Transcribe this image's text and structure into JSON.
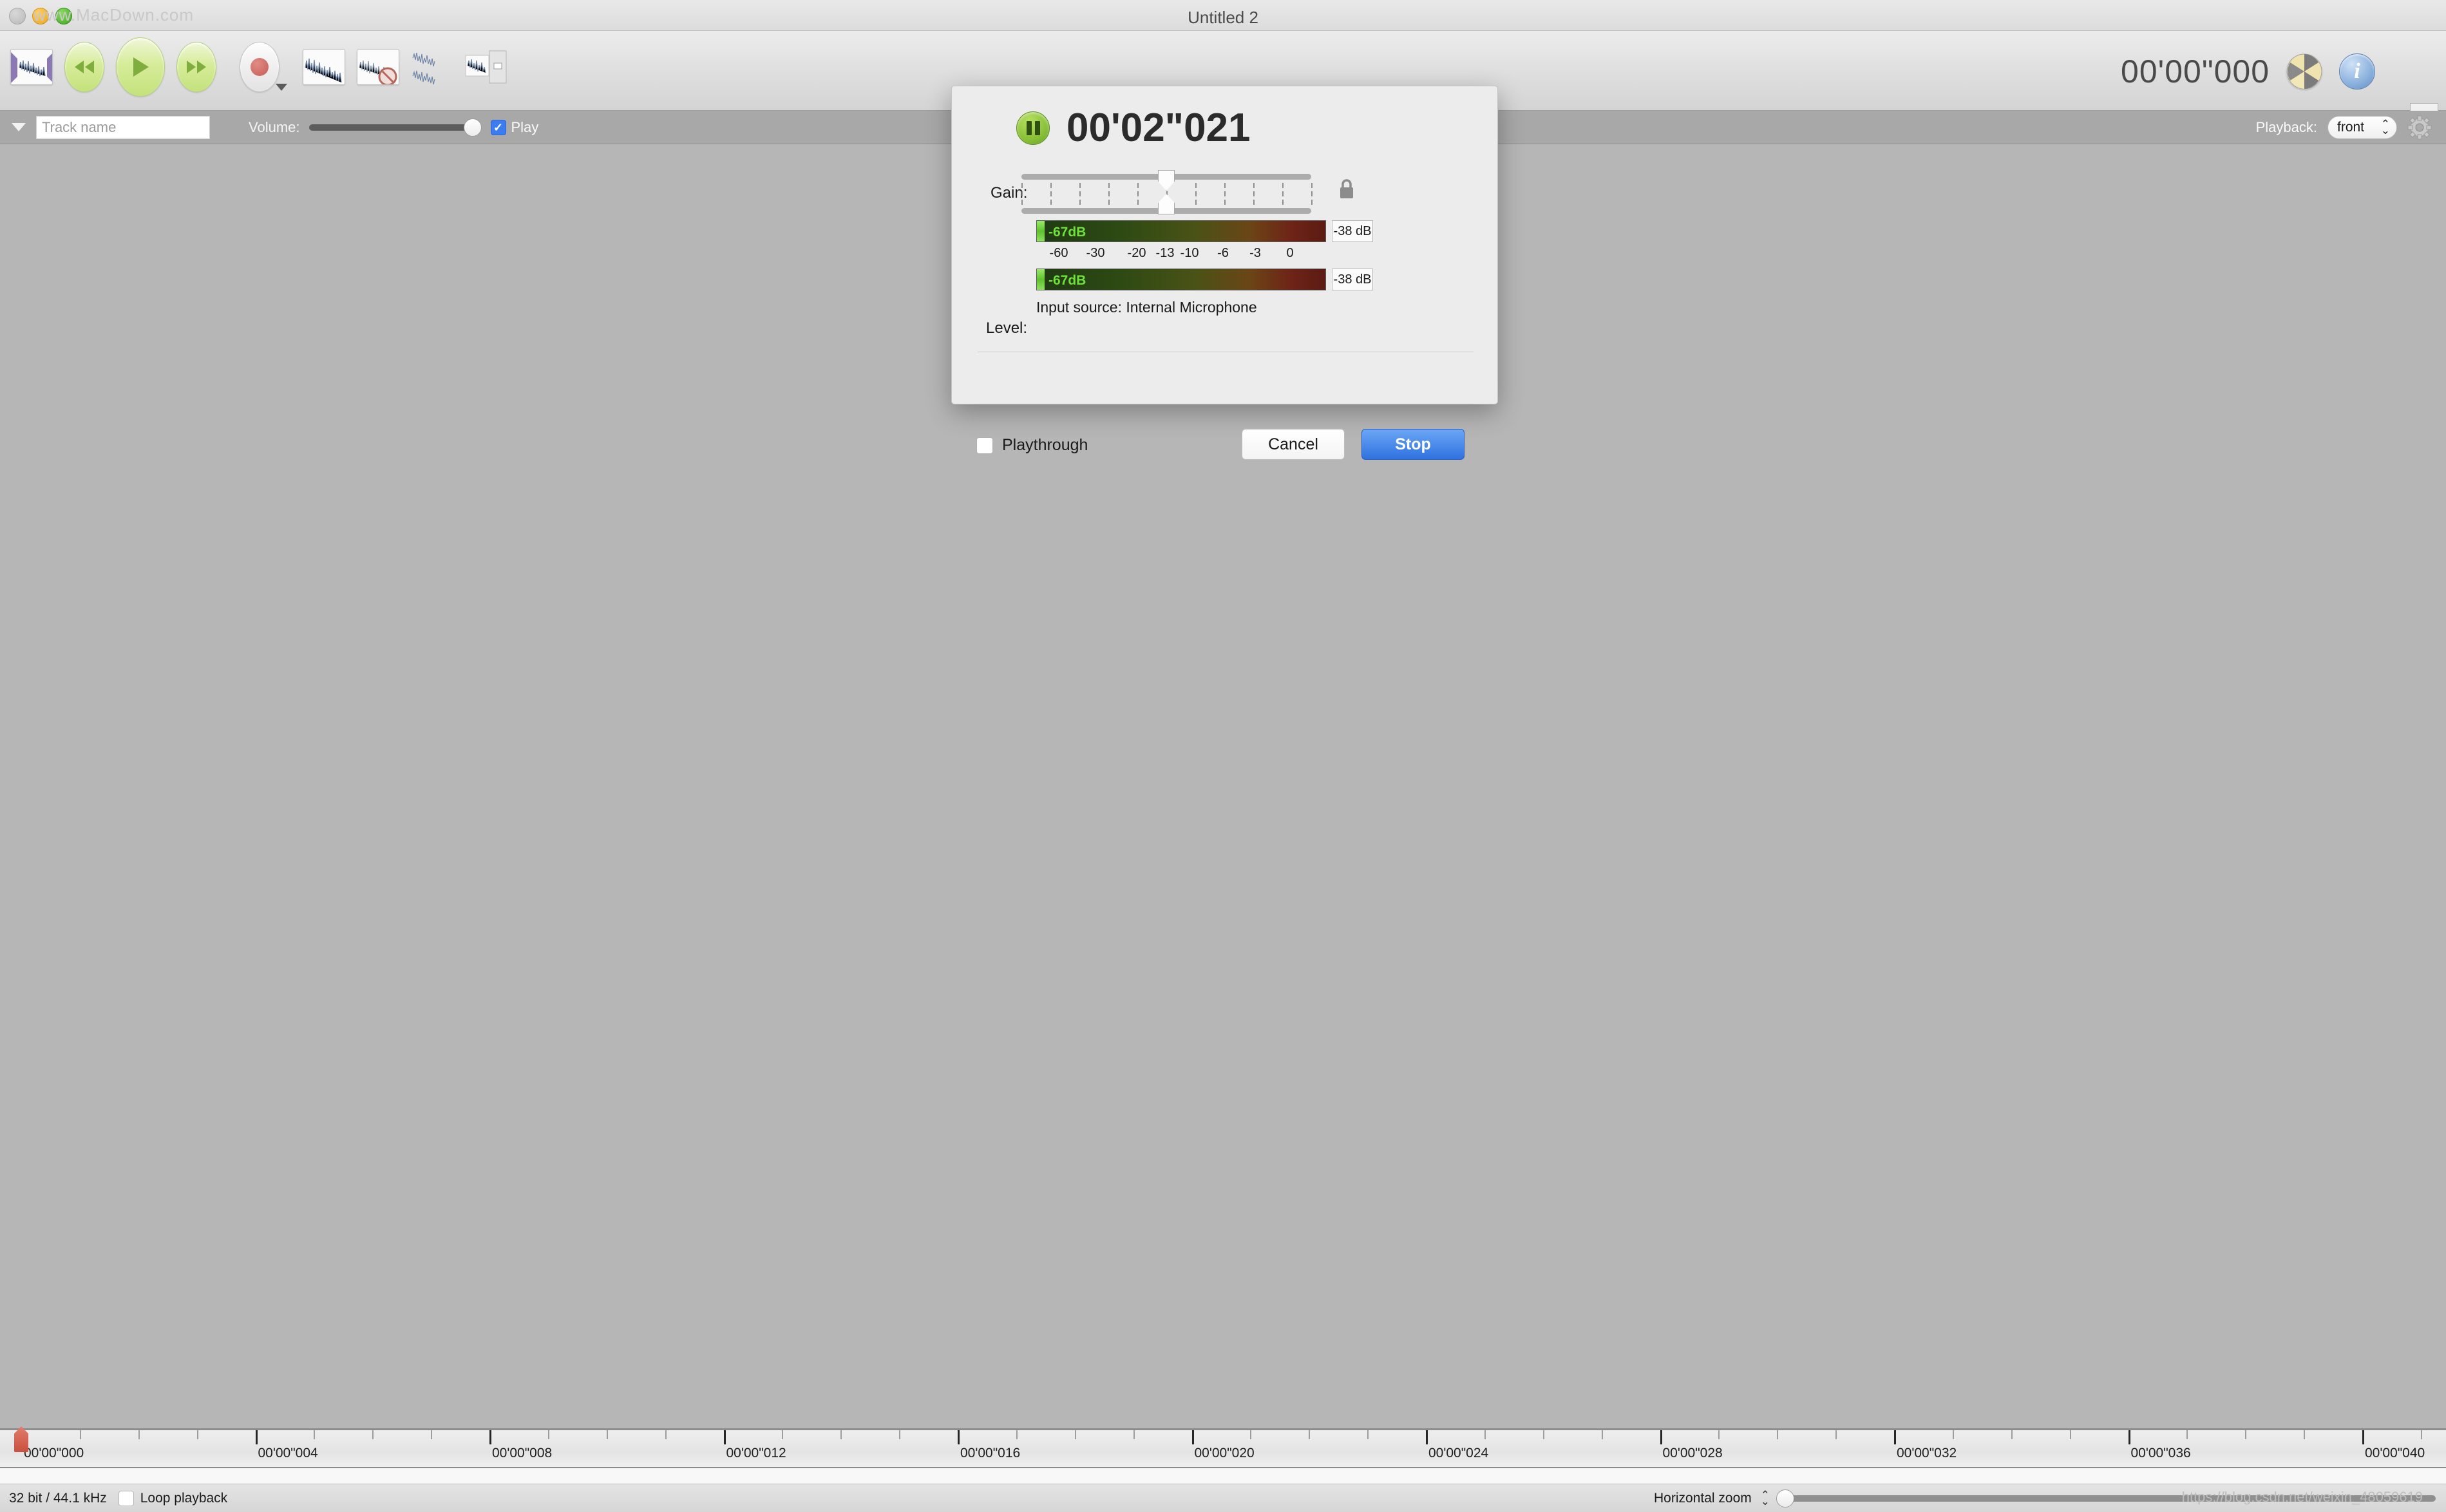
{
  "window": {
    "title": "Untitled 2",
    "watermark_top": "www.MacDown.com"
  },
  "toolbar": {
    "items": [
      {
        "name": "trim-selection",
        "label": "Trim to selection"
      },
      {
        "name": "rewind",
        "label": "Rewind"
      },
      {
        "name": "play",
        "label": "Play"
      },
      {
        "name": "fast-forward",
        "label": "Fast forward"
      },
      {
        "name": "record",
        "label": "Record"
      },
      {
        "name": "normalize",
        "label": "Normalize"
      },
      {
        "name": "silence",
        "label": "Silence"
      },
      {
        "name": "split-channels",
        "label": "Split channels"
      },
      {
        "name": "edit-waveform",
        "label": "Edit waveform"
      }
    ],
    "clock": "00'00\"000",
    "burn_icon": "burn-icon",
    "info_icon": "info-icon"
  },
  "track": {
    "disclosure_icon": "disclosure-triangle-icon",
    "name_placeholder": "Track name",
    "name_value": "",
    "volume_label": "Volume:",
    "volume_percent": 100,
    "play_label": "Play",
    "play_checked": true,
    "playback_label": "Playback:",
    "playback_value": "front",
    "gear_icon": "gear-icon"
  },
  "ruler": {
    "labels": [
      "00'00\"000",
      "00'00\"004",
      "00'00\"008",
      "00'00\"012",
      "00'00\"016",
      "00'00\"020",
      "00'00\"024",
      "00'00\"028",
      "00'00\"032",
      "00'00\"036",
      "00'00\"040"
    ],
    "playhead_position": "00'00\"000"
  },
  "status": {
    "format": "32 bit / 44.1 kHz",
    "loop_label": "Loop playback",
    "loop_checked": false,
    "zoom_label": "Horizontal zoom",
    "zoom_percent": 0,
    "watermark": "https://blog.csdn.net/weixin_48059619"
  },
  "dialog": {
    "pause_icon": "pause-icon",
    "clock": "00'02\"021",
    "gain_label": "Gain:",
    "gain_value_percent": 50,
    "lock_icon": "lock-icon",
    "level_label": "Level:",
    "meters": [
      {
        "reading": "-67dB",
        "db_field": "-38 dB",
        "fill_percent": 2.7
      },
      {
        "reading": "-67dB",
        "db_field": "-38 dB",
        "fill_percent": 2.7
      }
    ],
    "scale_ticks": [
      "-60",
      "-30",
      "-20",
      "-13",
      "-10",
      "-6",
      "-3",
      "0"
    ],
    "input_source": "Input source: Internal Microphone",
    "playthrough_label": "Playthrough",
    "playthrough_checked": false,
    "cancel_label": "Cancel",
    "stop_label": "Stop",
    "accent_color": "#2f72e0"
  }
}
